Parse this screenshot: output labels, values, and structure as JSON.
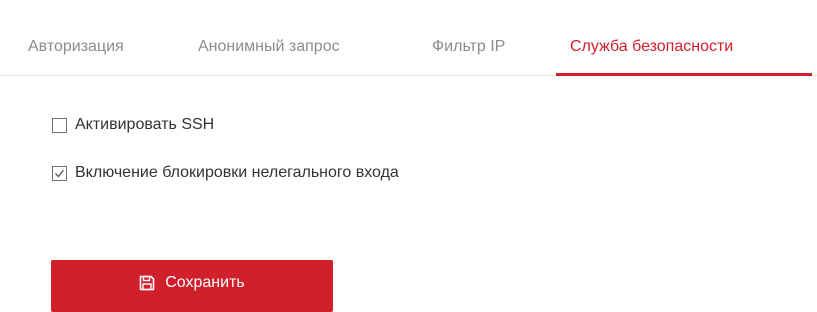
{
  "tabs": [
    {
      "label": "Авторизация",
      "active": false
    },
    {
      "label": "Анонимный запрос",
      "active": false
    },
    {
      "label": "Фильтр IP",
      "active": false
    },
    {
      "label": "Служба безопасности",
      "active": true
    }
  ],
  "options": [
    {
      "label": "Активировать SSH",
      "checked": false
    },
    {
      "label": "Включение блокировки нелегального входа",
      "checked": true
    }
  ],
  "save_button": {
    "label": "Сохранить",
    "icon": "save-icon"
  },
  "colors": {
    "accent": "#d0202c",
    "inactive_tab": "#8c8c8c",
    "text": "#333333"
  }
}
